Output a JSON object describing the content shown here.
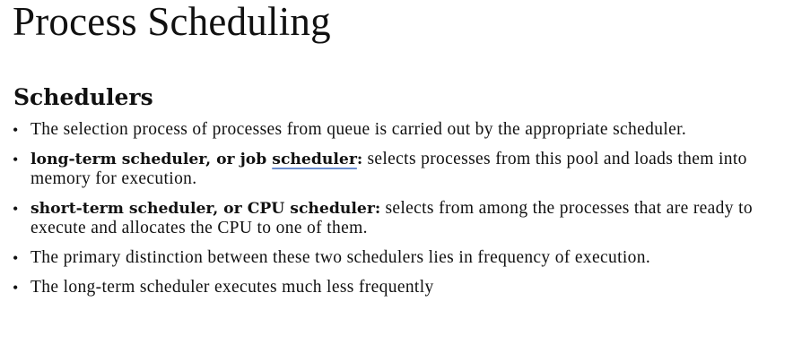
{
  "slide": {
    "title": "Process Scheduling",
    "heading": "Schedulers",
    "bullets": [
      {
        "text": "The selection process of processes from queue is carried out by the appropriate scheduler."
      },
      {
        "term_part1": "long-term scheduler, or job ",
        "term_part2": "scheduler",
        "term_part3": ":",
        "text": " selects processes from this pool and loads them into memory for execution."
      },
      {
        "term": "short-term scheduler, or CPU scheduler:",
        "text": " selects from among the processes that are ready to execute and allocates the CPU to one of them."
      },
      {
        "text": "The primary distinction between these two schedulers lies in frequency of execution."
      },
      {
        "text": "The long-term scheduler executes much less frequently"
      }
    ]
  }
}
